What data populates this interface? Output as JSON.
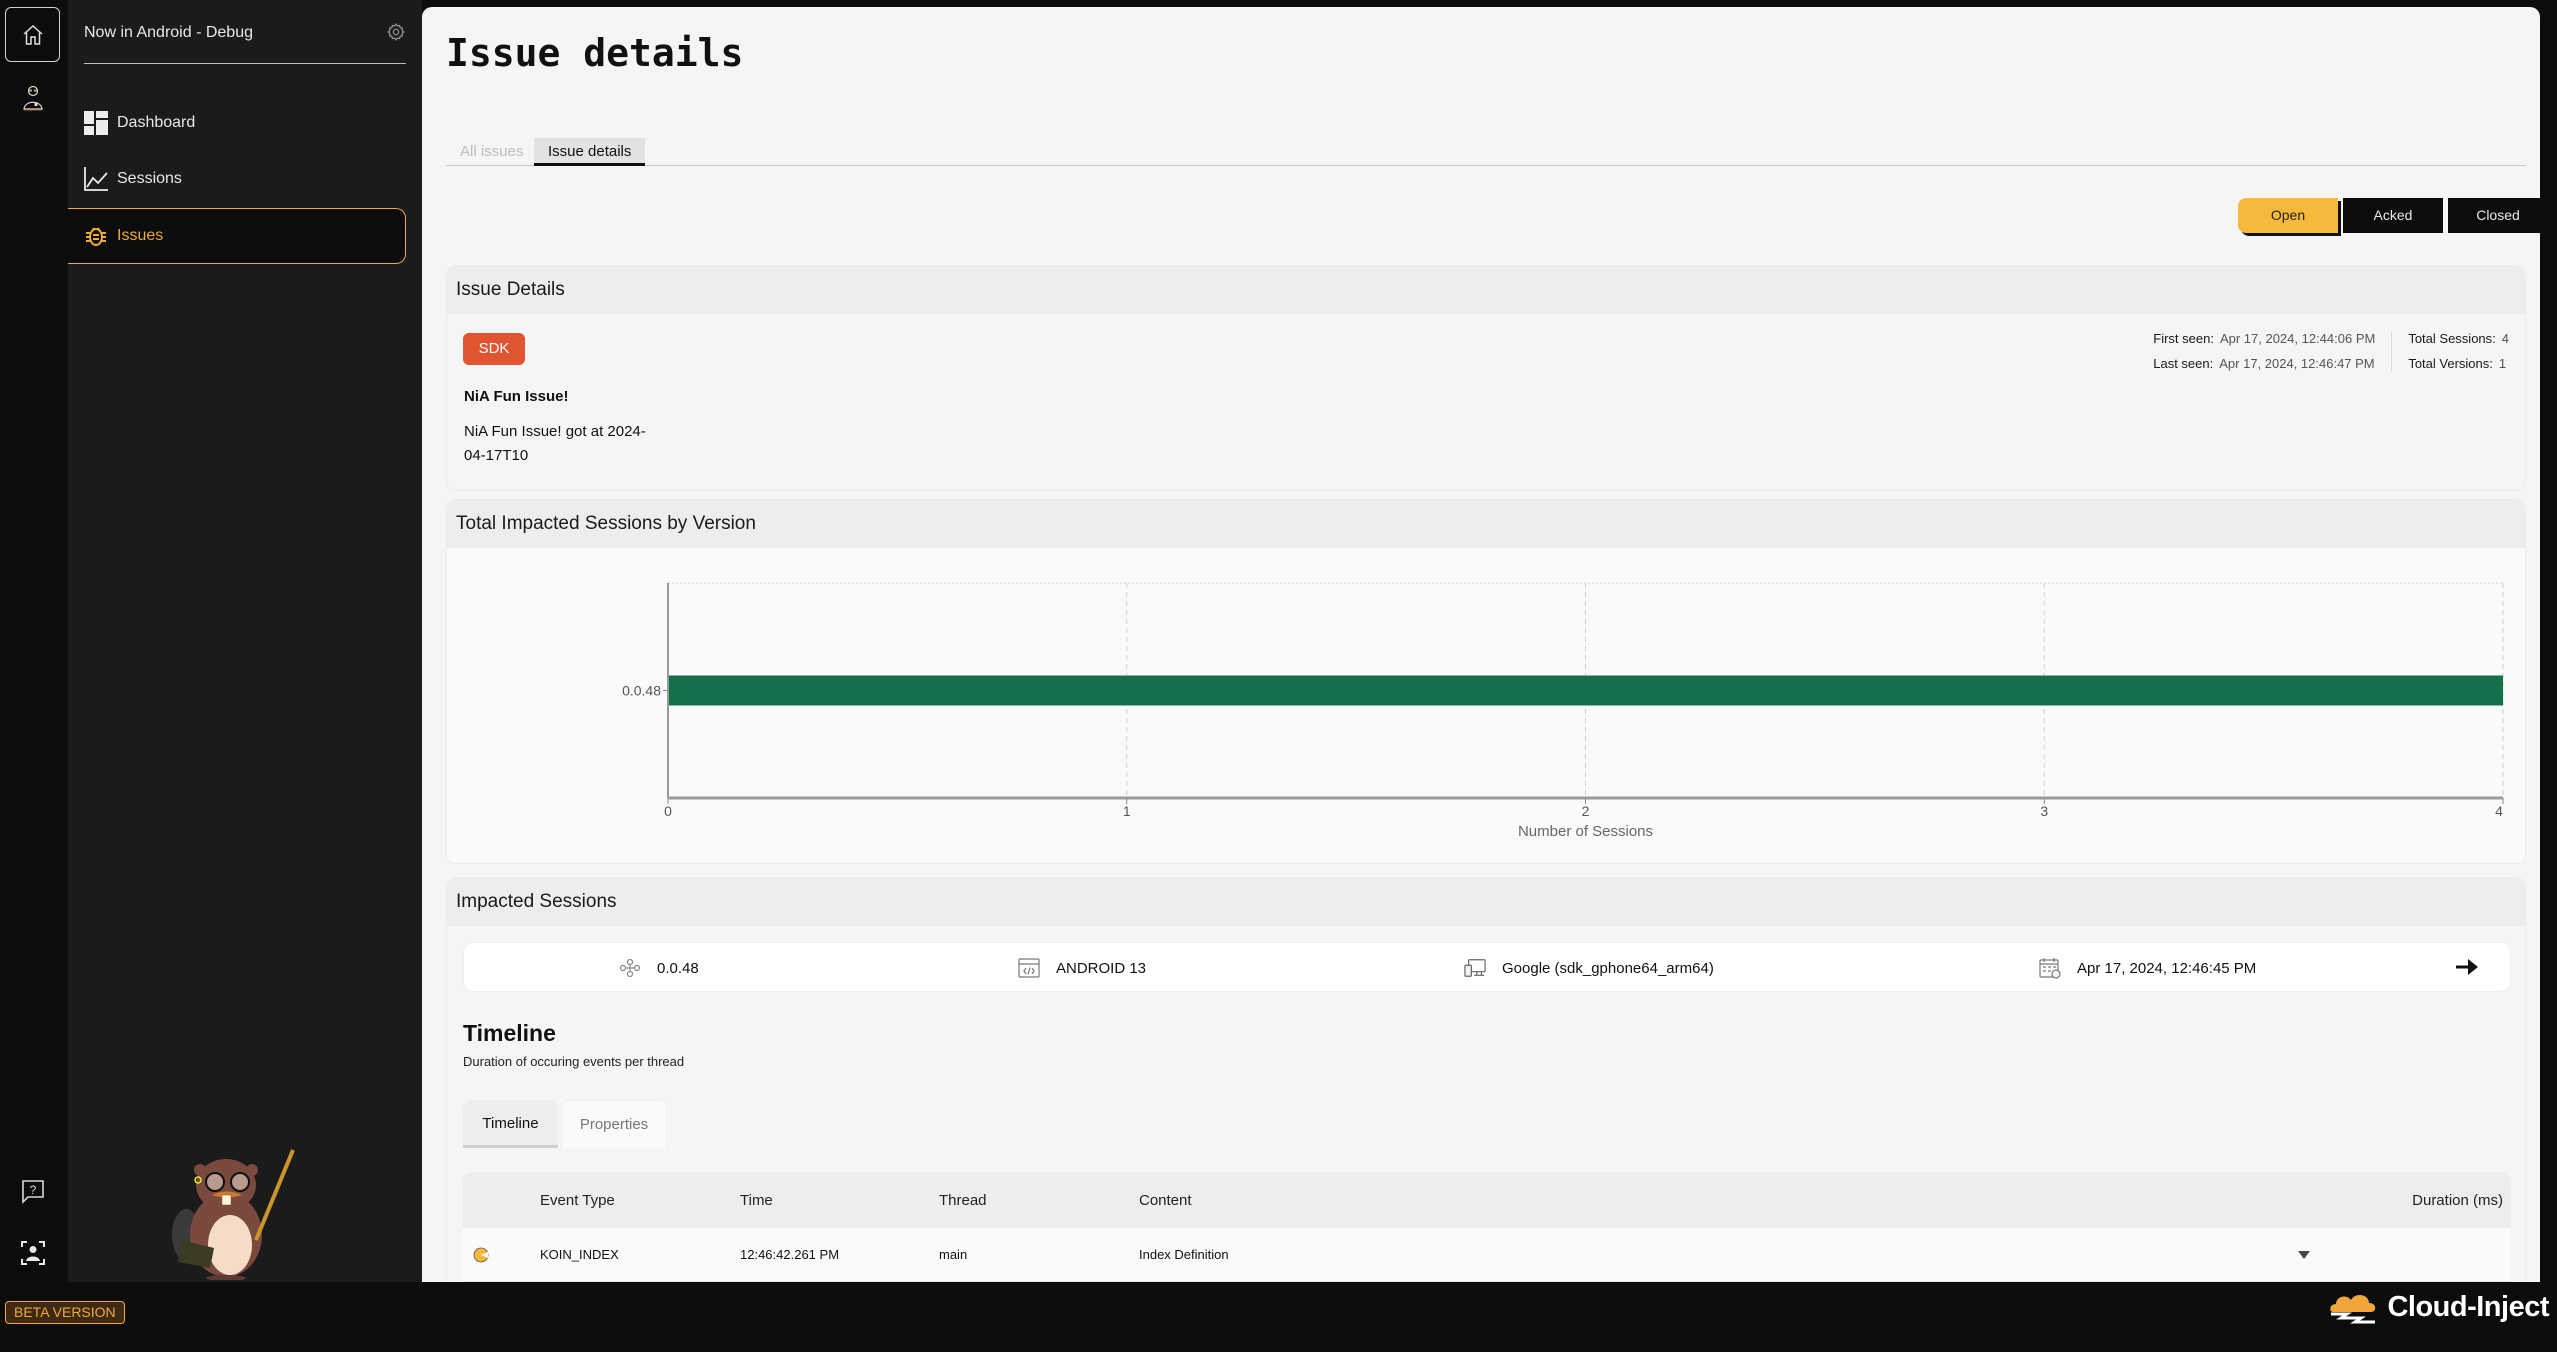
{
  "sidebar": {
    "project_name": "Now in Android - Debug",
    "nav": [
      {
        "label": "Dashboard",
        "icon": "dashboard-icon"
      },
      {
        "label": "Sessions",
        "icon": "chart-line-icon"
      },
      {
        "label": "Issues",
        "icon": "bug-icon",
        "active": true
      }
    ]
  },
  "footer": {
    "beta_label": "BETA VERSION",
    "brand_name": "Cloud-Inject"
  },
  "page": {
    "title": "Issue details",
    "tabs": [
      {
        "label": "All issues",
        "active": false
      },
      {
        "label": "Issue details",
        "active": true
      }
    ],
    "status_buttons": [
      {
        "label": "Open",
        "active": true
      },
      {
        "label": "Acked",
        "active": false
      },
      {
        "label": "Closed",
        "active": false
      }
    ]
  },
  "issue": {
    "section_title": "Issue Details",
    "badge": "SDK",
    "title": "NiA Fun Issue!",
    "description": "NiA Fun Issue! got at 2024-04-17T10",
    "first_seen_label": "First seen:",
    "first_seen": "Apr 17, 2024, 12:44:06 PM",
    "last_seen_label": "Last seen:",
    "last_seen": "Apr 17, 2024, 12:46:47 PM",
    "total_sessions_label": "Total Sessions:",
    "total_sessions": "4",
    "total_versions_label": "Total Versions:",
    "total_versions": "1"
  },
  "chart_section_title": "Total Impacted Sessions by Version",
  "chart_data": {
    "type": "bar",
    "orientation": "horizontal",
    "title": "Total Impacted Sessions by Version",
    "categories": [
      "0.0.48"
    ],
    "values": [
      4
    ],
    "xlabel": "Number of Sessions",
    "ylabel": "",
    "xlim": [
      0,
      4
    ],
    "xticks": [
      "0",
      "1",
      "2",
      "3",
      "4"
    ],
    "grid": true,
    "bar_color": "#14704b"
  },
  "sessions": {
    "section_title": "Impacted Sessions",
    "rows": [
      {
        "version": "0.0.48",
        "os": "ANDROID 13",
        "device": "Google (sdk_gphone64_arm64)",
        "date": "Apr 17, 2024, 12:46:45 PM"
      }
    ]
  },
  "timeline": {
    "title": "Timeline",
    "subtitle": "Duration of occuring events per thread",
    "tabs": [
      {
        "label": "Timeline",
        "active": true
      },
      {
        "label": "Properties",
        "active": false
      }
    ],
    "columns": [
      "Event Type",
      "Time",
      "Thread",
      "Content",
      "Duration (ms)"
    ],
    "rows": [
      {
        "event_type": "KOIN_INDEX",
        "time": "12:46:42.261 PM",
        "thread": "main",
        "content": "Index Definition",
        "duration": ""
      }
    ]
  },
  "colors": {
    "accent": "#f0a93a",
    "open_button": "#f6b93b",
    "sdk_badge": "#e0552f",
    "bar": "#14704b"
  }
}
